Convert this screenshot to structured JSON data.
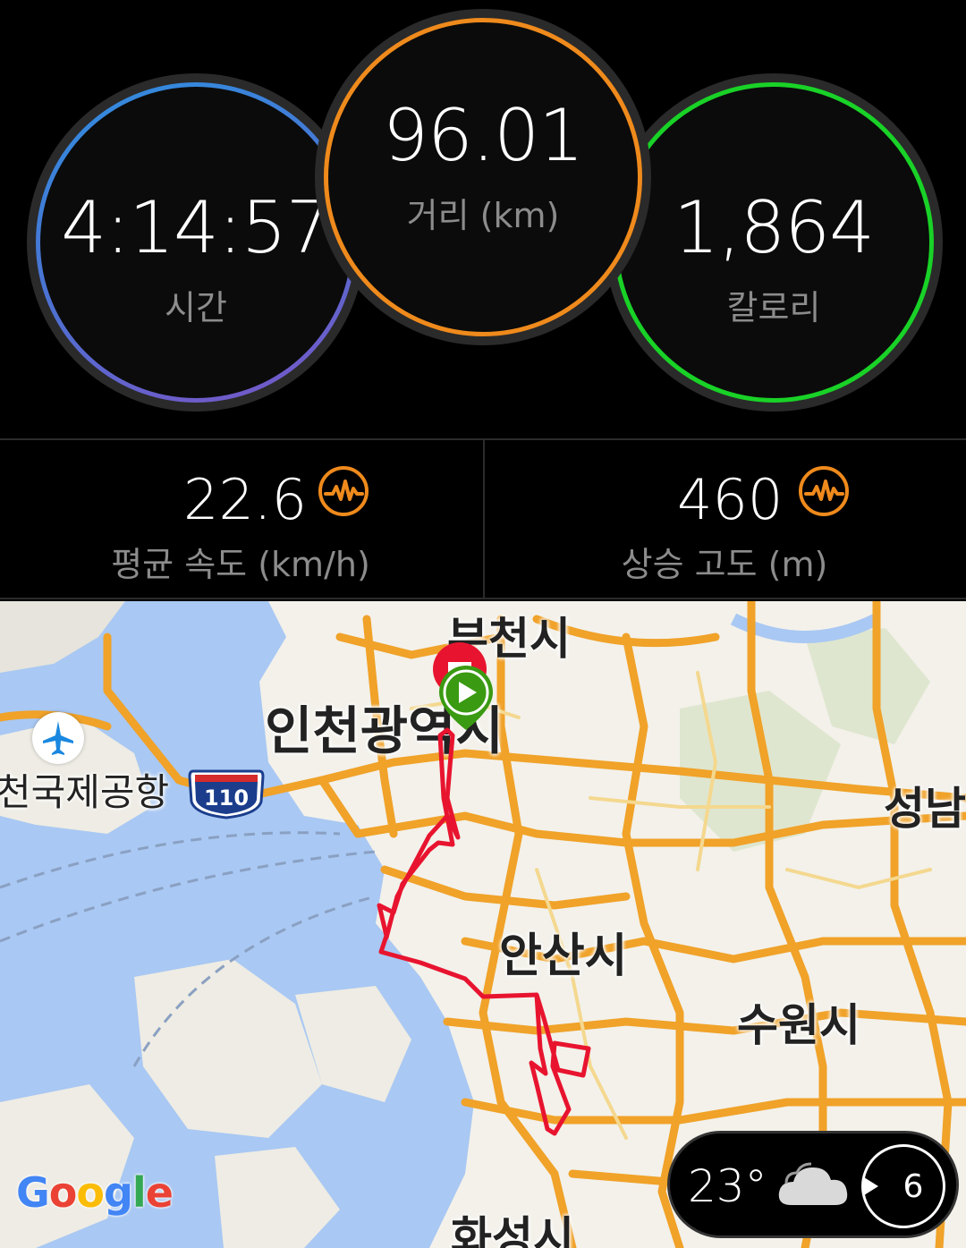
{
  "stats": {
    "time": {
      "value": "4:14:57",
      "label": "시간"
    },
    "distance": {
      "value": "96.01",
      "label": "거리 (km)"
    },
    "calories": {
      "value": "1,864",
      "label": "칼로리"
    }
  },
  "metrics": {
    "avg_speed": {
      "value": "22.6",
      "label": "평균 속도 (km/h)",
      "icon": "waveform-icon"
    },
    "elevation_gain": {
      "value": "460",
      "label": "상승 고도 (m)",
      "icon": "waveform-icon"
    }
  },
  "map": {
    "labels": {
      "bucheon": "부천시",
      "incheon": "인천광역시",
      "airport": "천국제공항",
      "ansan": "안산시",
      "suwon": "수원시",
      "seongnam": "성남",
      "hwaseong": "화성시"
    },
    "route_shield": "110",
    "google_logo": "Google",
    "route_color": "#e8142f",
    "start_marker_color": "#3a9a12",
    "end_marker_color": "#e8142f"
  },
  "weather": {
    "temperature": "23°",
    "condition_icon": "cloud-icon",
    "wind_speed": "6"
  },
  "colors": {
    "time_ring": "#2e8fe0",
    "distance_ring": "#ef8a1c",
    "calories_ring": "#19d227",
    "metric_icon": "#ef8a1c"
  }
}
